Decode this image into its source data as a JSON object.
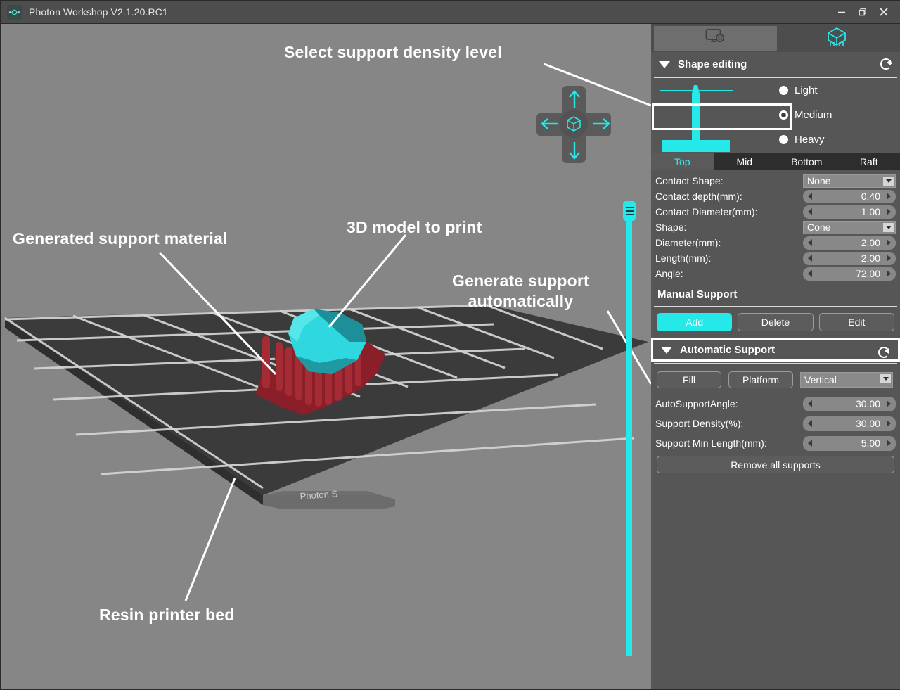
{
  "titlebar": {
    "app_icon": "photon-app-icon",
    "title": "Photon Workshop V2.1.20.RC1",
    "minimize_label": "minimize-icon",
    "maximize_label": "restore-icon",
    "close_label": "close-icon"
  },
  "viewport": {
    "bed_label": "Photon S",
    "nav_gizmo": {
      "up": "arrow-up-icon",
      "down": "arrow-down-icon",
      "left": "arrow-left-icon",
      "right": "arrow-right-icon",
      "center": "cube-icon"
    },
    "slider": {
      "handle": "slider-handle"
    },
    "annotations": [
      {
        "id": "density",
        "text": "Select support density level"
      },
      {
        "id": "support",
        "text": "Generated support material"
      },
      {
        "id": "model",
        "text": "3D model to print"
      },
      {
        "id": "auto",
        "text": "Generate support\nautomatically"
      },
      {
        "id": "bed",
        "text": "Resin printer bed"
      }
    ],
    "colors": {
      "model": "#2fd8df",
      "supports": "#9c2530",
      "bed": "#3a3a3a",
      "background": "#868686",
      "accent": "#25e8e8"
    }
  },
  "panel": {
    "tabs": [
      {
        "name": "settings",
        "icon": "monitor-gear-icon",
        "active": false
      },
      {
        "name": "support",
        "icon": "supported-model-icon",
        "active": true
      }
    ],
    "shape_editing": {
      "title": "Shape editing",
      "refresh_icon": "refresh-icon",
      "collapse_icon": "triangle-down-icon",
      "density": {
        "options": [
          "Light",
          "Medium",
          "Heavy"
        ],
        "selected": "Medium",
        "highlighted": "Medium"
      },
      "subtabs": [
        {
          "label": "Top",
          "active": true
        },
        {
          "label": "Mid",
          "active": false
        },
        {
          "label": "Bottom",
          "active": false
        },
        {
          "label": "Raft",
          "active": false
        }
      ],
      "params": [
        {
          "label": "Contact Shape:",
          "type": "select",
          "value": "None"
        },
        {
          "label": "Contact depth(mm):",
          "type": "spin",
          "value": "0.40"
        },
        {
          "label": "Contact Diameter(mm):",
          "type": "spin",
          "value": "1.00"
        },
        {
          "label": "Shape:",
          "type": "select",
          "value": "Cone"
        },
        {
          "label": "Diameter(mm):",
          "type": "spin",
          "value": "2.00"
        },
        {
          "label": "Length(mm):",
          "type": "spin",
          "value": "2.00"
        },
        {
          "label": "Angle:",
          "type": "spin",
          "value": "72.00"
        }
      ],
      "manual_support": {
        "title": "Manual Support",
        "buttons": [
          {
            "label": "Add",
            "primary": true
          },
          {
            "label": "Delete",
            "primary": false
          },
          {
            "label": "Edit",
            "primary": false
          }
        ]
      }
    },
    "automatic_support": {
      "title": "Automatic Support",
      "refresh_icon": "refresh-icon",
      "collapse_icon": "triangle-down-icon",
      "highlighted": true,
      "buttons": [
        {
          "label": "Fill"
        },
        {
          "label": "Platform"
        }
      ],
      "orientation": {
        "value": "Vertical"
      },
      "params": [
        {
          "label": "AutoSupportAngle:",
          "value": "30.00"
        },
        {
          "label": "Support Density(%):",
          "value": "30.00"
        },
        {
          "label": "Support Min Length(mm):",
          "value": "5.00"
        }
      ],
      "remove_all_label": "Remove all supports"
    }
  }
}
